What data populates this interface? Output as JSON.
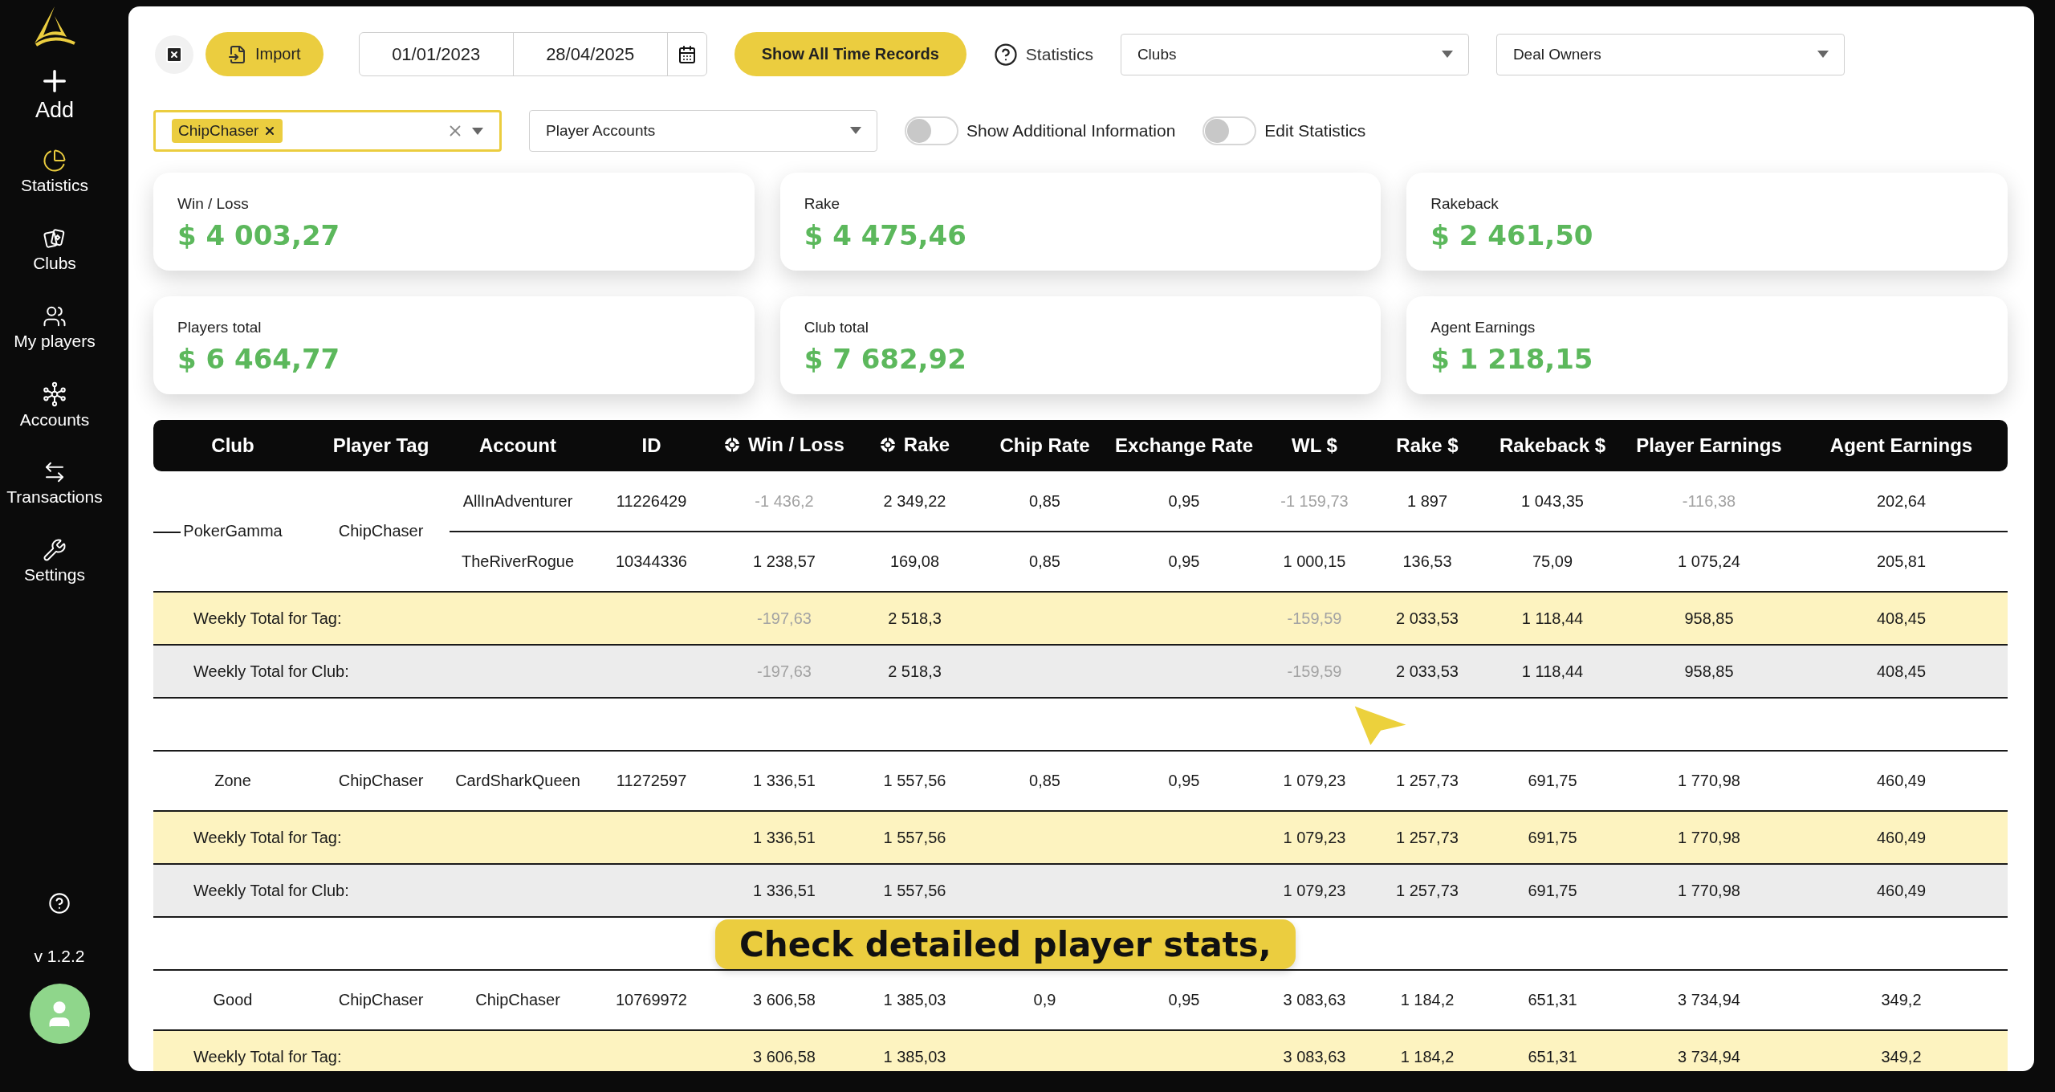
{
  "sidebar": {
    "add_label": "Add",
    "items": [
      {
        "label": "Statistics",
        "kind": "statistics",
        "selected": true
      },
      {
        "label": "Clubs",
        "kind": "clubs",
        "selected": false
      },
      {
        "label": "My players",
        "kind": "players",
        "selected": false
      },
      {
        "label": "Accounts",
        "kind": "accounts",
        "selected": false
      },
      {
        "label": "Transactions",
        "kind": "transactions",
        "selected": false
      },
      {
        "label": "Settings",
        "kind": "settings",
        "selected": false
      }
    ],
    "version": "v 1.2.2"
  },
  "toolbar": {
    "import_label": "Import",
    "date_from": "01/01/2023",
    "date_to": "28/04/2025",
    "all_time_button": "Show All Time Records",
    "statistics_label": "Statistics",
    "clubs_select": {
      "placeholder": "Clubs"
    },
    "deal_owners_select": {
      "placeholder": "Deal Owners"
    },
    "tag_chips": [
      "ChipChaser"
    ],
    "accounts_select": {
      "placeholder": "Player Accounts"
    },
    "toggles": [
      {
        "label": "Show Additional Information",
        "on": false
      },
      {
        "label": "Edit Statistics",
        "on": false
      }
    ]
  },
  "cards": [
    {
      "label": "Win / Loss",
      "value": "$ 4 003,27"
    },
    {
      "label": "Rake",
      "value": "$ 4 475,46"
    },
    {
      "label": "Rakeback",
      "value": "$ 2 461,50"
    },
    {
      "label": "Players total",
      "value": "$ 6 464,77"
    },
    {
      "label": "Club total",
      "value": "$ 7 682,92"
    },
    {
      "label": "Agent Earnings",
      "value": "$ 1 218,15"
    }
  ],
  "table": {
    "columns": [
      {
        "label": "Club",
        "kind": "plain"
      },
      {
        "label": "Player Tag",
        "kind": "plain"
      },
      {
        "label": "Account",
        "kind": "plain"
      },
      {
        "label": "ID",
        "kind": "plain"
      },
      {
        "label": "Win / Loss",
        "kind": "chip"
      },
      {
        "label": "Rake",
        "kind": "chip"
      },
      {
        "label": "Chip Rate",
        "kind": "plain"
      },
      {
        "label": "Exchange Rate",
        "kind": "plain"
      },
      {
        "label": "WL $",
        "kind": "plain"
      },
      {
        "label": "Rake $",
        "kind": "plain"
      },
      {
        "label": "Rakeback $",
        "kind": "plain"
      },
      {
        "label": "Player Earnings",
        "kind": "plain"
      },
      {
        "label": "Agent Earnings",
        "kind": "plain"
      }
    ],
    "groups": [
      {
        "club": "PokerGamma",
        "tag": "ChipChaser",
        "accounts": [
          {
            "account": "AllInAdventurer",
            "id": "11226429",
            "win_loss": {
              "text": "-1 436,2",
              "dimmed": true
            },
            "rake": "2 349,22",
            "chip_rate": "0,85",
            "exchange_rate": "0,95",
            "wl_usd": {
              "text": "-1 159,73",
              "dimmed": true
            },
            "rake_usd": "1 897",
            "rakeback_usd": "1 043,35",
            "player_earnings": {
              "text": "-116,38",
              "dimmed": true
            },
            "agent_earnings": "202,64"
          },
          {
            "account": "TheRiverRogue",
            "id": "10344336",
            "win_loss": "1 238,57",
            "rake": "169,08",
            "chip_rate": "0,85",
            "exchange_rate": "0,95",
            "wl_usd": "1 000,15",
            "rake_usd": "136,53",
            "rakeback_usd": "75,09",
            "player_earnings": "1 075,24",
            "agent_earnings": "205,81"
          }
        ],
        "tag_total": {
          "label": "Weekly Total for Tag:",
          "win_loss": {
            "text": "-197,63",
            "dimmed": true
          },
          "rake": "2 518,3",
          "wl_usd": {
            "text": "-159,59",
            "dimmed": true
          },
          "rake_usd": "2 033,53",
          "rakeback_usd": "1 118,44",
          "player_earnings": "958,85",
          "agent_earnings": "408,45"
        },
        "club_total": {
          "label": "Weekly Total for Club:",
          "win_loss": {
            "text": "-197,63",
            "dimmed": true
          },
          "rake": "2 518,3",
          "wl_usd": {
            "text": "-159,59",
            "dimmed": true
          },
          "rake_usd": "2 033,53",
          "rakeback_usd": "1 118,44",
          "player_earnings": "958,85",
          "agent_earnings": "408,45"
        }
      },
      {
        "club": "Zone",
        "tag": "ChipChaser",
        "accounts": [
          {
            "account": "CardSharkQueen",
            "id": "11272597",
            "win_loss": "1 336,51",
            "rake": "1 557,56",
            "chip_rate": "0,85",
            "exchange_rate": "0,95",
            "wl_usd": "1 079,23",
            "rake_usd": "1 257,73",
            "rakeback_usd": "691,75",
            "player_earnings": "1 770,98",
            "agent_earnings": "460,49"
          }
        ],
        "tag_total": {
          "label": "Weekly Total for Tag:",
          "win_loss": "1 336,51",
          "rake": "1 557,56",
          "wl_usd": "1 079,23",
          "rake_usd": "1 257,73",
          "rakeback_usd": "691,75",
          "player_earnings": "1 770,98",
          "agent_earnings": "460,49"
        },
        "club_total": {
          "label": "Weekly Total for Club:",
          "win_loss": "1 336,51",
          "rake": "1 557,56",
          "wl_usd": "1 079,23",
          "rake_usd": "1 257,73",
          "rakeback_usd": "691,75",
          "player_earnings": "1 770,98",
          "agent_earnings": "460,49"
        }
      },
      {
        "club": "Good",
        "tag": "ChipChaser",
        "accounts": [
          {
            "account": "ChipChaser",
            "id": "10769972",
            "win_loss": "3 606,58",
            "rake": "1 385,03",
            "chip_rate": "0,9",
            "exchange_rate": "0,95",
            "wl_usd": "3 083,63",
            "rake_usd": "1 184,2",
            "rakeback_usd": "651,31",
            "player_earnings": "3 734,94",
            "agent_earnings": "349,2"
          }
        ],
        "tag_total": {
          "label": "Weekly Total for Tag:",
          "win_loss": "3 606,58",
          "rake": "1 385,03",
          "wl_usd": "3 083,63",
          "rake_usd": "1 184,2",
          "rakeback_usd": "651,31",
          "player_earnings": "3 734,94",
          "agent_earnings": "349,2"
        }
      }
    ]
  },
  "caption": "Check detailed player stats,"
}
